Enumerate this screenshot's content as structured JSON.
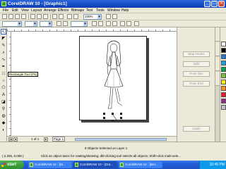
{
  "window": {
    "title": "CorelDRAW 10 - [Graphic1]",
    "controls": {
      "minimize": "_",
      "maximize": "□",
      "close": "✕"
    }
  },
  "menu": [
    "File",
    "Edit",
    "View",
    "Layout",
    "Arrange",
    "Effects",
    "Bitmaps",
    "Text",
    "Tools",
    "Window",
    "Help"
  ],
  "toolbar": {
    "zoom_value": "100%",
    "icons": [
      "new-icon",
      "open-icon",
      "save-icon",
      "print-icon",
      "cut-icon",
      "copy-icon",
      "paste-icon",
      "undo-icon",
      "redo-icon",
      "import-icon",
      "export-icon"
    ]
  },
  "property_bar": {
    "x_value": "",
    "y_value": "",
    "angle_value": ""
  },
  "tooltip": "Rectangle Tool (F6)",
  "docker": {
    "buttons": [
      "Map Nodes",
      "Split",
      "Fuse Sks",
      "Fuse End"
    ],
    "apply_label": "Apply"
  },
  "page_nav": {
    "counter": "1 of 1",
    "page_tab": "Page 1"
  },
  "status": {
    "selection": "5 Objects Selected on Layer 1",
    "coords": "( 2.255, 6.008 )",
    "hint": "Click an object twice for rotating/skewing; dbl-clicking tool selects all objects; Shift+click multi-sele..."
  },
  "taskbar": {
    "start": "start",
    "tasks": [
      "CorelDRAW 10 - [Di...",
      "CorelDRAW 10 - [Gra...",
      "CorelDRAW 10 - [Bro..."
    ],
    "clock": "10:45 PM"
  },
  "palette": [
    "#ffffff",
    "#000000",
    "#1f7ad8",
    "#18a0e0",
    "#00a651",
    "#7cc242",
    "#fff200",
    "#f7941d",
    "#ed1c24",
    "#92278f",
    "#c0c0c0"
  ],
  "colors": {
    "title_bar": "#1549c4",
    "taskbar": "#245edb",
    "start_button": "#2f8f2f"
  }
}
